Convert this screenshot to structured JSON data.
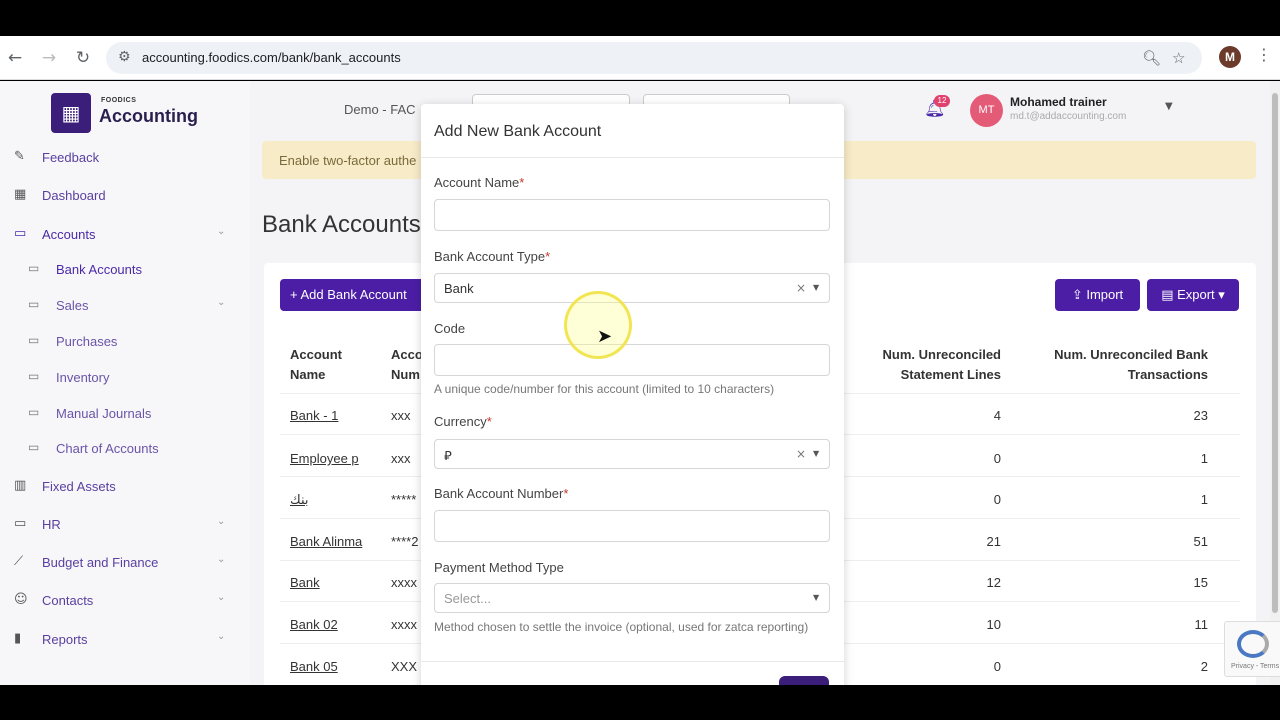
{
  "browser": {
    "url": "accounting.foodics.com/bank/bank_accounts",
    "profile_initial": "M"
  },
  "brand": {
    "small": "FOODICS",
    "title": "Accounting",
    "accent": "#4b1ea5"
  },
  "sidebar": {
    "items": [
      {
        "label": "Feedback",
        "icon": "feedback-icon"
      },
      {
        "label": "Dashboard",
        "icon": "dashboard-icon"
      },
      {
        "label": "Accounts",
        "icon": "wallet-icon"
      },
      {
        "label": "Bank Accounts",
        "icon": "briefcase-icon"
      },
      {
        "label": "Sales",
        "icon": "briefcase-icon"
      },
      {
        "label": "Purchases",
        "icon": "briefcase-icon"
      },
      {
        "label": "Inventory",
        "icon": "briefcase-icon"
      },
      {
        "label": "Manual Journals",
        "icon": "briefcase-icon"
      },
      {
        "label": "Chart of Accounts",
        "icon": "briefcase-icon"
      },
      {
        "label": "Fixed Assets",
        "icon": "building-icon"
      },
      {
        "label": "HR",
        "icon": "briefcase-icon"
      },
      {
        "label": "Budget and Finance",
        "icon": "chart-line-icon"
      },
      {
        "label": "Contacts",
        "icon": "contacts-icon"
      },
      {
        "label": "Reports",
        "icon": "bar-chart-icon"
      }
    ]
  },
  "header": {
    "org": "Demo - FAC",
    "notification_count": "12",
    "user_initials": "MT",
    "user_name": "Mohamed trainer",
    "user_email": "md.t@addaccounting.com"
  },
  "alert": {
    "text": "Enable two-factor authe"
  },
  "page": {
    "title": "Bank Accounts",
    "add_button": "+ Add Bank Account",
    "import_button": "Import",
    "export_button": "Export"
  },
  "table": {
    "headers": {
      "name_1": "Account",
      "name_2": "Name",
      "num_1": "Acco",
      "num_2": "Num",
      "unrec_stmt_1": "Num. Unreconciled",
      "unrec_stmt_2": "Statement Lines",
      "unrec_bank_1": "Num. Unreconciled Bank",
      "unrec_bank_2": "Transactions"
    },
    "rows": [
      {
        "name": "Bank - 1",
        "number": "xxx",
        "stmt": "4",
        "bank": "23"
      },
      {
        "name": "Employee p",
        "number": "xxx",
        "stmt": "0",
        "bank": "1"
      },
      {
        "name": "بنك",
        "number": "*****",
        "stmt": "0",
        "bank": "1"
      },
      {
        "name": "Bank Alinma",
        "number": "****2",
        "stmt": "21",
        "bank": "51"
      },
      {
        "name": "Bank",
        "number": "xxxx",
        "stmt": "12",
        "bank": "15"
      },
      {
        "name": "Bank 02",
        "number": "xxxx",
        "stmt": "10",
        "bank": "11"
      },
      {
        "name": "Bank 05",
        "number": "XXX",
        "stmt": "0",
        "bank": "2"
      }
    ]
  },
  "modal": {
    "title": "Add New Bank Account",
    "account_name_label": "Account Name",
    "bank_type_label": "Bank Account Type",
    "bank_type_value": "Bank",
    "code_label": "Code",
    "code_help": "A unique code/number for this account (limited to 10 characters)",
    "currency_label": "Currency",
    "currency_value": "⃁",
    "account_number_label": "Bank Account Number",
    "payment_method_label": "Payment Method Type",
    "payment_method_placeholder": "Select...",
    "payment_method_help": "Method chosen to settle the invoice (optional, used for zatca reporting)",
    "required_mark": "*"
  },
  "recaptcha": {
    "text": "Privacy - Terms"
  }
}
